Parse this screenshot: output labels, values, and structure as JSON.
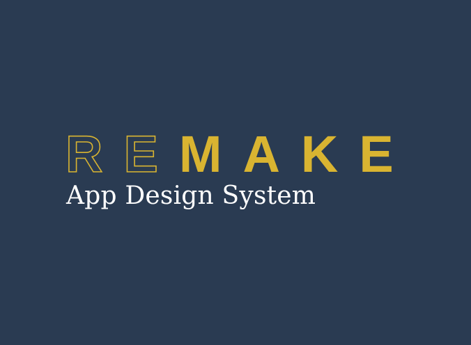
{
  "brand": {
    "logo_outline": "RE",
    "logo_solid": "MAKE",
    "tagline": "App Design System"
  },
  "colors": {
    "background": "#2a3b52",
    "accent": "#d9b431",
    "text": "#ffffff"
  }
}
